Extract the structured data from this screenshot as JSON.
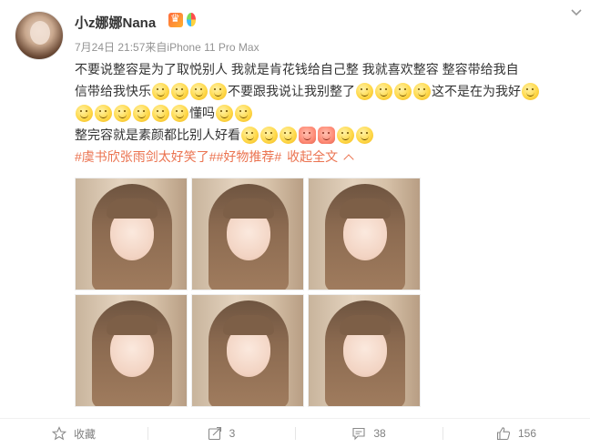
{
  "user": {
    "name": "小z娜娜Nana",
    "avatar_icon": "avatar-photo"
  },
  "badges": [
    "vip-icon",
    "balloon-icon"
  ],
  "meta": {
    "time": "7月24日 21:57",
    "source_prefix": "来自",
    "source": "iPhone 11 Pro Max"
  },
  "post": {
    "line1": "不要说整容是为了取悦别人 我就是肯花钱给自己整 我就喜欢整容 整容带给我自",
    "line2_a": "信带给我快乐",
    "line2_b": "不要跟我说让我别整了",
    "line2_c": "这不是在为我好",
    "line3": "懂吗",
    "line4": "整完容就是素颜都比别人好看",
    "tags": "#虞书欣张雨剑太好笑了##好物推荐#",
    "collapse_label": "收起全文"
  },
  "photos": [
    "photo-1",
    "photo-2",
    "photo-3",
    "photo-4",
    "photo-5",
    "photo-6"
  ],
  "actions": {
    "favorite_label": "收藏",
    "repost_count": "3",
    "comment_count": "38",
    "like_count": "156"
  },
  "colors": {
    "link": "#eb7350",
    "meta": "#939393",
    "text": "#333333"
  }
}
